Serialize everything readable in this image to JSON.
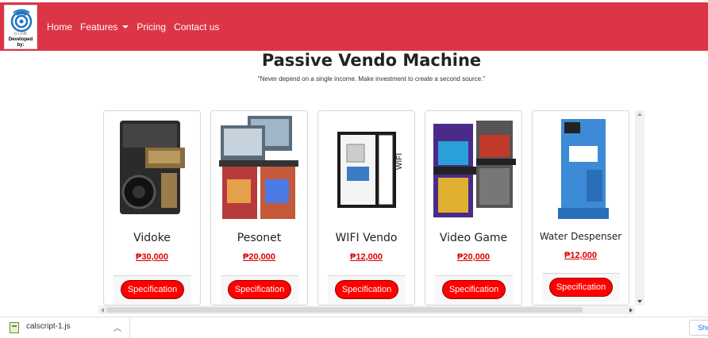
{
  "navbar": {
    "logo_text": "Developed by:",
    "logo_brand": "G LINK",
    "links": [
      "Home",
      "Features",
      "Pricing",
      "Contact us"
    ],
    "bg_color": "#dc3545"
  },
  "header": {
    "title": "Passive Vendo Machine",
    "subtitle": "\"Never depend on a single income. Make investment to create a second source.\""
  },
  "products": [
    {
      "name": "Vidoke",
      "price": "₱30,000",
      "button": "Specification",
      "icon": "karaoke-machine-icon"
    },
    {
      "name": "Pesonet",
      "price": "₱20,000",
      "button": "Specification",
      "icon": "pisonet-machine-icon"
    },
    {
      "name": "WIFI Vendo",
      "price": "₱12,000",
      "button": "Specification",
      "icon": "wifi-vendo-machine-icon"
    },
    {
      "name": "Video Game",
      "price": "₱20,000",
      "button": "Specification",
      "icon": "arcade-machine-icon"
    },
    {
      "name": "Water Despenser",
      "price": "₱12,000",
      "button": "Specification",
      "icon": "water-dispenser-machine-icon"
    }
  ],
  "download_bar": {
    "filename": "calscript-1.js",
    "show_all": "Sho"
  }
}
